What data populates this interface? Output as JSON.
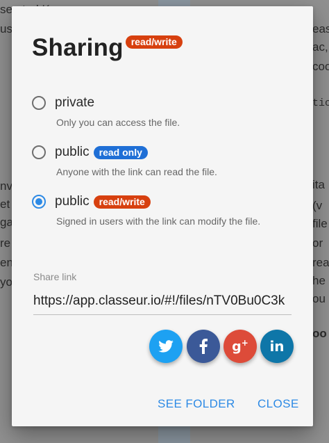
{
  "background": {
    "left_lines": [
      {
        "text": "se   ated K",
        "cls": ""
      },
      {
        "text": "  us",
        "cls": ""
      },
      {
        "text": "nv",
        "cls": ""
      },
      {
        "text": "et",
        "cls": ""
      },
      {
        "text": "ga",
        "cls": ""
      },
      {
        "text": "re",
        "cls": ""
      },
      {
        "text": "en,",
        "cls": ""
      },
      {
        "text": "yo",
        "cls": ""
      }
    ],
    "right_lines": [
      {
        "text": "eas",
        "cls": ""
      },
      {
        "text": "ac,",
        "cls": ""
      },
      {
        "text": "coo",
        "cls": ""
      },
      {
        "text": "tic",
        "cls": "mono"
      },
      {
        "text": "ita",
        "cls": ""
      },
      {
        "text": "(v",
        "cls": ""
      },
      {
        "text": "file",
        "cls": ""
      },
      {
        "text": "or",
        "cls": ""
      },
      {
        "text": "rea",
        "cls": ""
      },
      {
        "text": "he",
        "cls": ""
      },
      {
        "text": "ou",
        "cls": ""
      },
      {
        "text": "oo",
        "cls": "bold"
      }
    ]
  },
  "dialog": {
    "title": "Sharing",
    "title_badge": "read/write",
    "options": [
      {
        "label": "private",
        "badge": "",
        "description": "Only you can access the file.",
        "checked": false
      },
      {
        "label": "public",
        "badge": "read only",
        "description": "Anyone with the link can read the file.",
        "checked": false
      },
      {
        "label": "public",
        "badge": "read/write",
        "description": "Signed in users with the link can modify the file.",
        "checked": true
      }
    ],
    "share_link_label": "Share link",
    "share_link_value": "https://app.classeur.io/#!/files/nTV0Bu0C3k",
    "social": [
      {
        "name": "twitter",
        "icon": "twitter-icon"
      },
      {
        "name": "facebook",
        "icon": "facebook-icon"
      },
      {
        "name": "google-plus",
        "icon": "google-plus-icon"
      },
      {
        "name": "linkedin",
        "icon": "linkedin-icon"
      }
    ],
    "see_folder_label": "SEE FOLDER",
    "close_label": "CLOSE"
  },
  "colors": {
    "accent": "#2d8ae5",
    "badge_read_write": "#d7400f",
    "badge_read_only": "#1f6fd6",
    "twitter": "#1da1f2",
    "facebook": "#3b5998",
    "google_plus": "#dd4b39",
    "linkedin": "#0e76a8"
  }
}
